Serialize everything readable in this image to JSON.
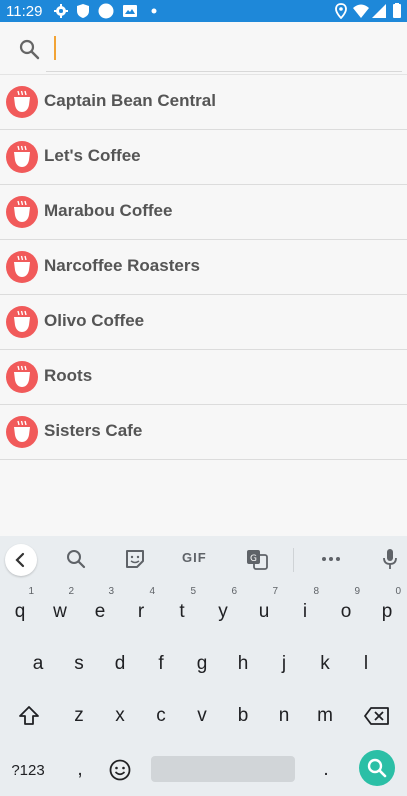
{
  "status_bar": {
    "time": "11:29",
    "left_icons": [
      "settings-icon",
      "shield-icon",
      "circle-icon",
      "mail-icon",
      "dot-icon"
    ],
    "right_icons": [
      "location-icon",
      "wifi-icon",
      "signal-icon",
      "battery-icon"
    ],
    "color": "#1e88d9"
  },
  "search": {
    "value": "",
    "placeholder": ""
  },
  "results": [
    {
      "label": "Captain Bean Central"
    },
    {
      "label": "Let's Coffee"
    },
    {
      "label": "Marabou Coffee"
    },
    {
      "label": "Narcoffee Roasters"
    },
    {
      "label": "Olivo Coffee"
    },
    {
      "label": "Roots"
    },
    {
      "label": "Sisters Cafe"
    }
  ],
  "keyboard": {
    "toolbar": {
      "gif_label": "GIF"
    },
    "row1": [
      {
        "key": "q",
        "hint": "1"
      },
      {
        "key": "w",
        "hint": "2"
      },
      {
        "key": "e",
        "hint": "3"
      },
      {
        "key": "r",
        "hint": "4"
      },
      {
        "key": "t",
        "hint": "5"
      },
      {
        "key": "y",
        "hint": "6"
      },
      {
        "key": "u",
        "hint": "7"
      },
      {
        "key": "i",
        "hint": "8"
      },
      {
        "key": "o",
        "hint": "9"
      },
      {
        "key": "p",
        "hint": "0"
      }
    ],
    "row2": [
      "a",
      "s",
      "d",
      "f",
      "g",
      "h",
      "j",
      "k",
      "l"
    ],
    "row3": [
      "z",
      "x",
      "c",
      "v",
      "b",
      "n",
      "m"
    ],
    "bottom": {
      "symbols": "?123",
      "comma": ",",
      "period": "."
    },
    "accent_color": "#2bbfa6"
  }
}
